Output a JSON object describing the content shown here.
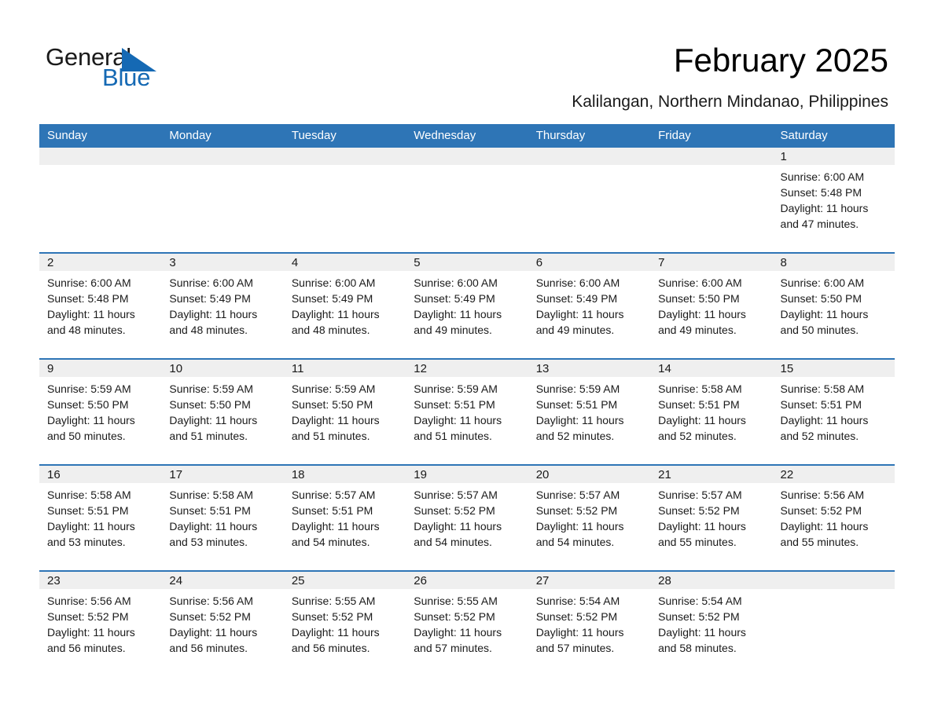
{
  "brand": {
    "name_part1": "General",
    "name_part2": "Blue",
    "triangle_color": "#1569b4",
    "blue_color": "#1569b4"
  },
  "header": {
    "month_title": "February 2025",
    "location": "Kalilangan, Northern Mindanao, Philippines"
  },
  "theme": {
    "header_blue": "#2e75b6",
    "daynum_strip": "#efefef",
    "divider_blue": "#2e75b6",
    "text": "#1a1a1a"
  },
  "weekday_headers": [
    "Sunday",
    "Monday",
    "Tuesday",
    "Wednesday",
    "Thursday",
    "Friday",
    "Saturday"
  ],
  "weeks": [
    [
      {
        "day": "",
        "sunrise": "",
        "sunset": "",
        "daylight1": "",
        "daylight2": ""
      },
      {
        "day": "",
        "sunrise": "",
        "sunset": "",
        "daylight1": "",
        "daylight2": ""
      },
      {
        "day": "",
        "sunrise": "",
        "sunset": "",
        "daylight1": "",
        "daylight2": ""
      },
      {
        "day": "",
        "sunrise": "",
        "sunset": "",
        "daylight1": "",
        "daylight2": ""
      },
      {
        "day": "",
        "sunrise": "",
        "sunset": "",
        "daylight1": "",
        "daylight2": ""
      },
      {
        "day": "",
        "sunrise": "",
        "sunset": "",
        "daylight1": "",
        "daylight2": ""
      },
      {
        "day": "1",
        "sunrise": "Sunrise: 6:00 AM",
        "sunset": "Sunset: 5:48 PM",
        "daylight1": "Daylight: 11 hours",
        "daylight2": "and 47 minutes."
      }
    ],
    [
      {
        "day": "2",
        "sunrise": "Sunrise: 6:00 AM",
        "sunset": "Sunset: 5:48 PM",
        "daylight1": "Daylight: 11 hours",
        "daylight2": "and 48 minutes."
      },
      {
        "day": "3",
        "sunrise": "Sunrise: 6:00 AM",
        "sunset": "Sunset: 5:49 PM",
        "daylight1": "Daylight: 11 hours",
        "daylight2": "and 48 minutes."
      },
      {
        "day": "4",
        "sunrise": "Sunrise: 6:00 AM",
        "sunset": "Sunset: 5:49 PM",
        "daylight1": "Daylight: 11 hours",
        "daylight2": "and 48 minutes."
      },
      {
        "day": "5",
        "sunrise": "Sunrise: 6:00 AM",
        "sunset": "Sunset: 5:49 PM",
        "daylight1": "Daylight: 11 hours",
        "daylight2": "and 49 minutes."
      },
      {
        "day": "6",
        "sunrise": "Sunrise: 6:00 AM",
        "sunset": "Sunset: 5:49 PM",
        "daylight1": "Daylight: 11 hours",
        "daylight2": "and 49 minutes."
      },
      {
        "day": "7",
        "sunrise": "Sunrise: 6:00 AM",
        "sunset": "Sunset: 5:50 PM",
        "daylight1": "Daylight: 11 hours",
        "daylight2": "and 49 minutes."
      },
      {
        "day": "8",
        "sunrise": "Sunrise: 6:00 AM",
        "sunset": "Sunset: 5:50 PM",
        "daylight1": "Daylight: 11 hours",
        "daylight2": "and 50 minutes."
      }
    ],
    [
      {
        "day": "9",
        "sunrise": "Sunrise: 5:59 AM",
        "sunset": "Sunset: 5:50 PM",
        "daylight1": "Daylight: 11 hours",
        "daylight2": "and 50 minutes."
      },
      {
        "day": "10",
        "sunrise": "Sunrise: 5:59 AM",
        "sunset": "Sunset: 5:50 PM",
        "daylight1": "Daylight: 11 hours",
        "daylight2": "and 51 minutes."
      },
      {
        "day": "11",
        "sunrise": "Sunrise: 5:59 AM",
        "sunset": "Sunset: 5:50 PM",
        "daylight1": "Daylight: 11 hours",
        "daylight2": "and 51 minutes."
      },
      {
        "day": "12",
        "sunrise": "Sunrise: 5:59 AM",
        "sunset": "Sunset: 5:51 PM",
        "daylight1": "Daylight: 11 hours",
        "daylight2": "and 51 minutes."
      },
      {
        "day": "13",
        "sunrise": "Sunrise: 5:59 AM",
        "sunset": "Sunset: 5:51 PM",
        "daylight1": "Daylight: 11 hours",
        "daylight2": "and 52 minutes."
      },
      {
        "day": "14",
        "sunrise": "Sunrise: 5:58 AM",
        "sunset": "Sunset: 5:51 PM",
        "daylight1": "Daylight: 11 hours",
        "daylight2": "and 52 minutes."
      },
      {
        "day": "15",
        "sunrise": "Sunrise: 5:58 AM",
        "sunset": "Sunset: 5:51 PM",
        "daylight1": "Daylight: 11 hours",
        "daylight2": "and 52 minutes."
      }
    ],
    [
      {
        "day": "16",
        "sunrise": "Sunrise: 5:58 AM",
        "sunset": "Sunset: 5:51 PM",
        "daylight1": "Daylight: 11 hours",
        "daylight2": "and 53 minutes."
      },
      {
        "day": "17",
        "sunrise": "Sunrise: 5:58 AM",
        "sunset": "Sunset: 5:51 PM",
        "daylight1": "Daylight: 11 hours",
        "daylight2": "and 53 minutes."
      },
      {
        "day": "18",
        "sunrise": "Sunrise: 5:57 AM",
        "sunset": "Sunset: 5:51 PM",
        "daylight1": "Daylight: 11 hours",
        "daylight2": "and 54 minutes."
      },
      {
        "day": "19",
        "sunrise": "Sunrise: 5:57 AM",
        "sunset": "Sunset: 5:52 PM",
        "daylight1": "Daylight: 11 hours",
        "daylight2": "and 54 minutes."
      },
      {
        "day": "20",
        "sunrise": "Sunrise: 5:57 AM",
        "sunset": "Sunset: 5:52 PM",
        "daylight1": "Daylight: 11 hours",
        "daylight2": "and 54 minutes."
      },
      {
        "day": "21",
        "sunrise": "Sunrise: 5:57 AM",
        "sunset": "Sunset: 5:52 PM",
        "daylight1": "Daylight: 11 hours",
        "daylight2": "and 55 minutes."
      },
      {
        "day": "22",
        "sunrise": "Sunrise: 5:56 AM",
        "sunset": "Sunset: 5:52 PM",
        "daylight1": "Daylight: 11 hours",
        "daylight2": "and 55 minutes."
      }
    ],
    [
      {
        "day": "23",
        "sunrise": "Sunrise: 5:56 AM",
        "sunset": "Sunset: 5:52 PM",
        "daylight1": "Daylight: 11 hours",
        "daylight2": "and 56 minutes."
      },
      {
        "day": "24",
        "sunrise": "Sunrise: 5:56 AM",
        "sunset": "Sunset: 5:52 PM",
        "daylight1": "Daylight: 11 hours",
        "daylight2": "and 56 minutes."
      },
      {
        "day": "25",
        "sunrise": "Sunrise: 5:55 AM",
        "sunset": "Sunset: 5:52 PM",
        "daylight1": "Daylight: 11 hours",
        "daylight2": "and 56 minutes."
      },
      {
        "day": "26",
        "sunrise": "Sunrise: 5:55 AM",
        "sunset": "Sunset: 5:52 PM",
        "daylight1": "Daylight: 11 hours",
        "daylight2": "and 57 minutes."
      },
      {
        "day": "27",
        "sunrise": "Sunrise: 5:54 AM",
        "sunset": "Sunset: 5:52 PM",
        "daylight1": "Daylight: 11 hours",
        "daylight2": "and 57 minutes."
      },
      {
        "day": "28",
        "sunrise": "Sunrise: 5:54 AM",
        "sunset": "Sunset: 5:52 PM",
        "daylight1": "Daylight: 11 hours",
        "daylight2": "and 58 minutes."
      },
      {
        "day": "",
        "sunrise": "",
        "sunset": "",
        "daylight1": "",
        "daylight2": ""
      }
    ]
  ]
}
